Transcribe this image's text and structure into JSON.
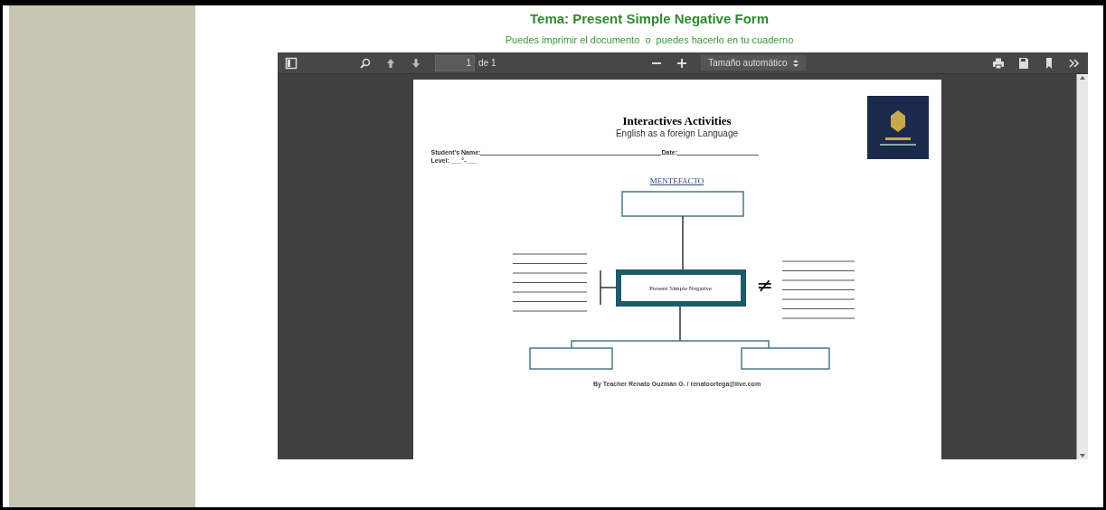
{
  "header": {
    "title": "Tema: Present Simple Negative Form",
    "subtitle": "Puedes imprimir el documento  o  puedes hacerlo en tu cuaderno"
  },
  "viewer": {
    "page_input": "1",
    "page_count": "de 1",
    "zoom": "Tamaño automático"
  },
  "document": {
    "title": "Interactives Activities",
    "subtitle": "English as a foreign Language",
    "name_label": "Student's Name:",
    "date_label": "Date:",
    "level_label": "Level:",
    "level_blank": "___°-___",
    "diagram_title": "MENTEFACTO",
    "center_box": "Present Simple Negative",
    "not_equal": "≠",
    "footer": "By Teacher Renato Guzmán G. / renatoortega@live.com"
  }
}
